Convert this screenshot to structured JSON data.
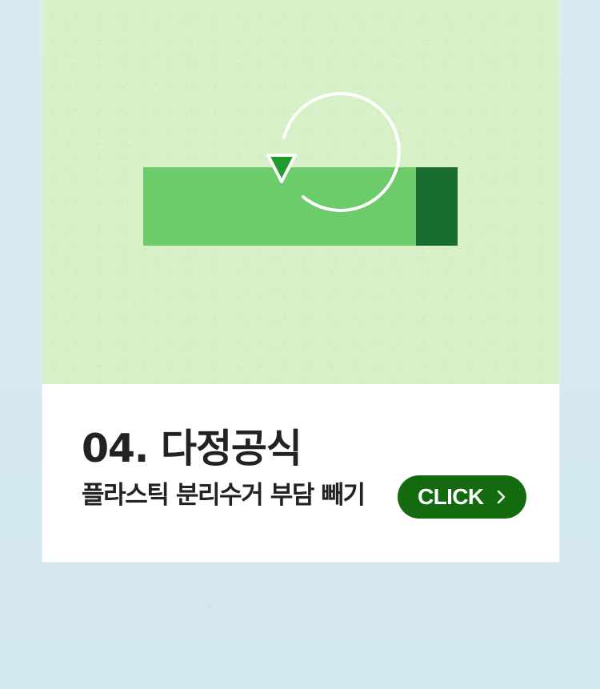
{
  "card": {
    "title": "04. 다정공식",
    "subtitle": "플라스틱 분리수거 부담 빼기",
    "button_label": "CLICK"
  },
  "illustration": {
    "icon_name": "recycle-refresh-icon",
    "colors": {
      "background": "#d7f0c8",
      "bar": "#6ccc6a",
      "bar_end": "#1a6d31",
      "arrow": "#ffffff",
      "arrow_head": "#1f9a2d"
    }
  },
  "button": {
    "icon_name": "chevron-right-icon",
    "color": "#146b0f"
  },
  "page": {
    "background": "#d6e9ef",
    "card_background": "#ffffff"
  }
}
